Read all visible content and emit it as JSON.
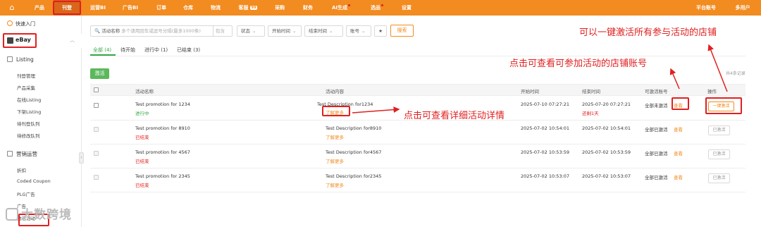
{
  "topnav": {
    "items": [
      {
        "label": "产品",
        "dot": false
      },
      {
        "label": "刊登",
        "dot": false
      },
      {
        "label": "运营BI",
        "dot": false
      },
      {
        "label": "广告BI",
        "dot": false
      },
      {
        "label": "订单",
        "dot": false
      },
      {
        "label": "仓库",
        "dot": false
      },
      {
        "label": "物流",
        "dot": false
      },
      {
        "label": "客服",
        "badge": "99"
      },
      {
        "label": "采购",
        "dot": false
      },
      {
        "label": "财务",
        "dot": false
      },
      {
        "label": "AI生成",
        "dot": true
      },
      {
        "label": "选品",
        "dot": true
      },
      {
        "label": "设置",
        "dot": false
      }
    ],
    "right": [
      "平台账号",
      "多用户"
    ],
    "colors": {
      "bar": "#f28b20",
      "active": "#d9661a"
    }
  },
  "sidebar": {
    "quick": "快速入门",
    "platform": "eBay",
    "listing": {
      "title": "Listing",
      "items": [
        "刊登管理",
        "产品采集",
        "在线Listing",
        "下架Listing",
        "待刊登队列",
        "待修改队列"
      ]
    },
    "marketing": {
      "title": "营销运营",
      "items": [
        "折扣",
        "Coded Coupon",
        "PLG广告",
        "广告",
        "激活活动"
      ]
    }
  },
  "filters": {
    "activity_name_label": "活动名称",
    "activity_name_placeholder": "多个请用回车或逗号分隔(最多1000条)",
    "mode": "包含",
    "status": "状态",
    "start_time": "开始时间",
    "end_time": "结束时间",
    "account": "账号",
    "search": "搜索"
  },
  "tabs": [
    {
      "label": "全部",
      "count": "(4)"
    },
    {
      "label": "待开始",
      "count": ""
    },
    {
      "label": "进行中",
      "count": "(1)"
    },
    {
      "label": "已结束",
      "count": "(3)"
    }
  ],
  "activate_button": "激活",
  "total": "共4条记录",
  "table": {
    "headers": [
      "活动名称",
      "活动内容",
      "开始时间",
      "结束时间",
      "可激活账号",
      "操作"
    ],
    "rows": [
      {
        "name": "Test promotion for 1234",
        "status": "进行中",
        "status_type": "running",
        "content": "Test Description for1234",
        "more": "了解更多",
        "start": "2025-07-10 07:27:21",
        "end": "2025-07-20 07:27:21",
        "end_note": "还剩1天",
        "accounts": "全部未激活",
        "view": "查看",
        "action": "一键激活",
        "action_enabled": true
      },
      {
        "name": "Test promotion for 8910",
        "status": "已结束",
        "status_type": "ended",
        "content": "Test Description for8910",
        "more": "了解更多",
        "start": "2025-07-02 10:54:01",
        "end": "2025-07-02 10:54:01",
        "end_note": "",
        "accounts": "全部已激活",
        "view": "查看",
        "action": "已激活",
        "action_enabled": false
      },
      {
        "name": "Test promotion for 4567",
        "status": "已结束",
        "status_type": "ended",
        "content": "Test Description for4567",
        "more": "了解更多",
        "start": "2025-07-02 10:53:59",
        "end": "2025-07-02 10:53:59",
        "end_note": "",
        "accounts": "全部已激活",
        "view": "查看",
        "action": "已激活",
        "action_enabled": false
      },
      {
        "name": "Test promotion for 2345",
        "status": "已结束",
        "status_type": "ended",
        "content": "Test Description for2345",
        "more": "了解更多",
        "start": "2025-07-02 10:53:07",
        "end": "2025-07-02 10:53:07",
        "end_note": "",
        "accounts": "全部已激活",
        "view": "查看",
        "action": "已激活",
        "action_enabled": false
      }
    ]
  },
  "annotations": {
    "one_click": "可以一键激活所有参与活动的店铺",
    "view_accounts": "点击可查看可参加活动的店铺账号",
    "view_detail": "点击可查看详细活动详情",
    "color": "#e02020"
  },
  "watermark": "大数跨境"
}
